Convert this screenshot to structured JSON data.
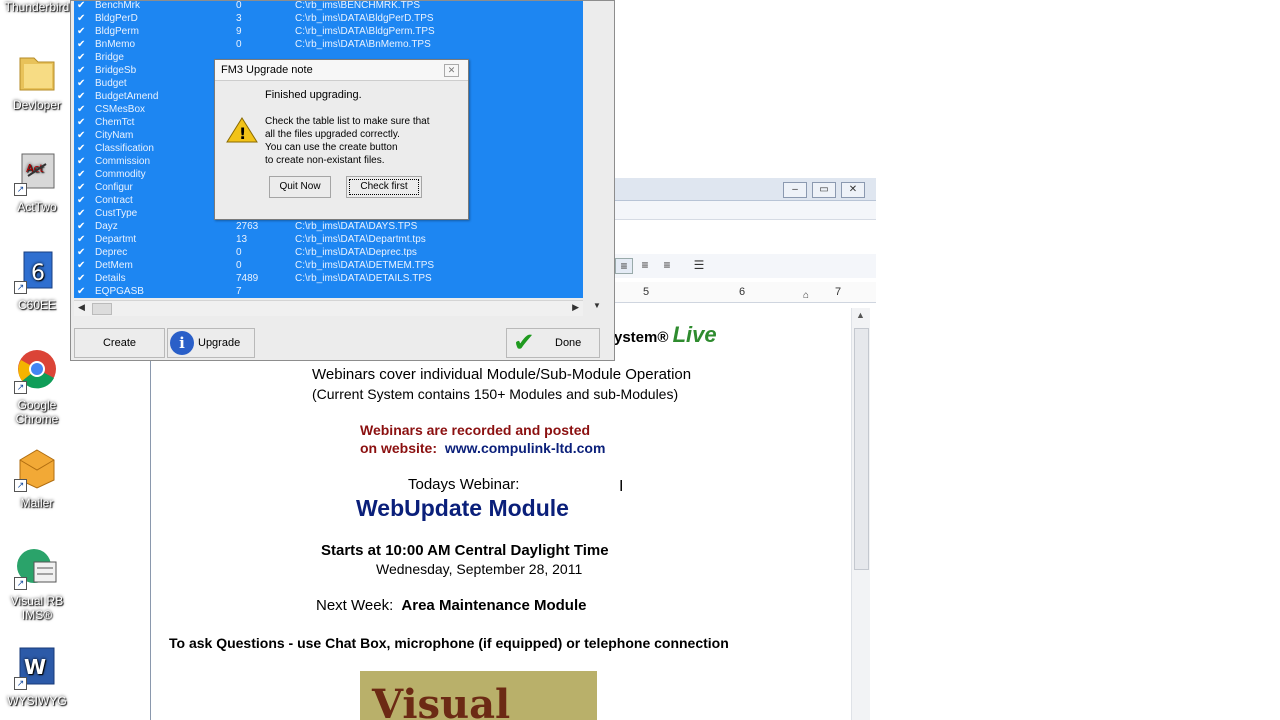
{
  "desktop": {
    "icons": [
      {
        "label": "Thunderbird"
      },
      {
        "label": "Devloper"
      },
      {
        "label": "ActTwo"
      },
      {
        "label": "C60EE"
      },
      {
        "label": "Google Chrome"
      },
      {
        "label": "Mailer"
      },
      {
        "label": "Visual RB IMS®"
      },
      {
        "label": "WYSIWYG"
      }
    ]
  },
  "fm3": {
    "tables": [
      {
        "name": "BenchMrk",
        "count": "0",
        "path": "C:\\rb_ims\\BENCHMRK.TPS"
      },
      {
        "name": "BldgPerD",
        "count": "3",
        "path": "C:\\rb_ims\\DATA\\BldgPerD.TPS"
      },
      {
        "name": "BldgPerm",
        "count": "9",
        "path": "C:\\rb_ims\\DATA\\BldgPerm.TPS"
      },
      {
        "name": "BnMemo",
        "count": "0",
        "path": "C:\\rb_ims\\DATA\\BnMemo.TPS"
      },
      {
        "name": "Bridge",
        "count": "",
        "path": ""
      },
      {
        "name": "BridgeSb",
        "count": "",
        "path": ""
      },
      {
        "name": "Budget",
        "count": "",
        "path": ""
      },
      {
        "name": "BudgetAmend",
        "count": "",
        "path": ""
      },
      {
        "name": "CSMesBox",
        "count": "",
        "path": ""
      },
      {
        "name": "ChemTct",
        "count": "",
        "path": ""
      },
      {
        "name": "CityNam",
        "count": "",
        "path": ""
      },
      {
        "name": "Classification",
        "count": "",
        "path": ""
      },
      {
        "name": "Commission",
        "count": "",
        "path": ""
      },
      {
        "name": "Commodity",
        "count": "",
        "path": ""
      },
      {
        "name": "Configur",
        "count": "",
        "path": ""
      },
      {
        "name": "Contract",
        "count": "",
        "path": ""
      },
      {
        "name": "CustType",
        "count": "",
        "path": ""
      },
      {
        "name": "Dayz",
        "count": "2763",
        "path": "C:\\rb_ims\\DATA\\DAYS.TPS"
      },
      {
        "name": "Departmt",
        "count": "13",
        "path": "C:\\rb_ims\\DATA\\Departmt.tps"
      },
      {
        "name": "Deprec",
        "count": "0",
        "path": "C:\\rb_ims\\DATA\\Deprec.tps"
      },
      {
        "name": "DetMem",
        "count": "0",
        "path": "C:\\rb_ims\\DATA\\DETMEM.TPS"
      },
      {
        "name": "Details",
        "count": "7489",
        "path": "C:\\rb_ims\\DATA\\DETAILS.TPS"
      },
      {
        "name": "EQPGASB",
        "count": "7",
        "path": ""
      }
    ],
    "buttons": {
      "create": "Create",
      "upgrade": "Upgrade",
      "done": "Done"
    }
  },
  "modal": {
    "title": "FM3 Upgrade note",
    "line1": "Finished upgrading.",
    "line2": "Check the table list to make sure that",
    "line3": "all the files upgraded correctly.",
    "line4": "You can use the create button",
    "line5": "to create non-existant files.",
    "quit": "Quit Now",
    "check": "Check first"
  },
  "doc": {
    "ruler": [
      "5",
      "6",
      "7"
    ],
    "heading_part": "ystem®",
    "heading_live": "Live",
    "line1": "Webinars cover individual Module/Sub-Module Operation",
    "line2": "(Current System contains 150+ Modules and sub-Modules)",
    "recorded": "Webinars are recorded and posted",
    "website_label": "on website:",
    "website_url": "www.compulink-ltd.com",
    "todays": "Todays Webinar:",
    "module": "WebUpdate Module",
    "starts": "Starts at 10:00 AM Central Daylight Time",
    "date": "Wednesday, September 28, 2011",
    "nextweek_label": "Next Week:",
    "nextweek_value": "Area Maintenance Module",
    "questions": "To ask Questions - use Chat Box, microphone (if equipped) or telephone connection",
    "banner": "Visual"
  },
  "colors": {
    "list_bg": "#1d86f2",
    "live_green": "#2e8b2e",
    "recorded_red": "#8b1010",
    "module_navy": "#0a1f7a"
  }
}
